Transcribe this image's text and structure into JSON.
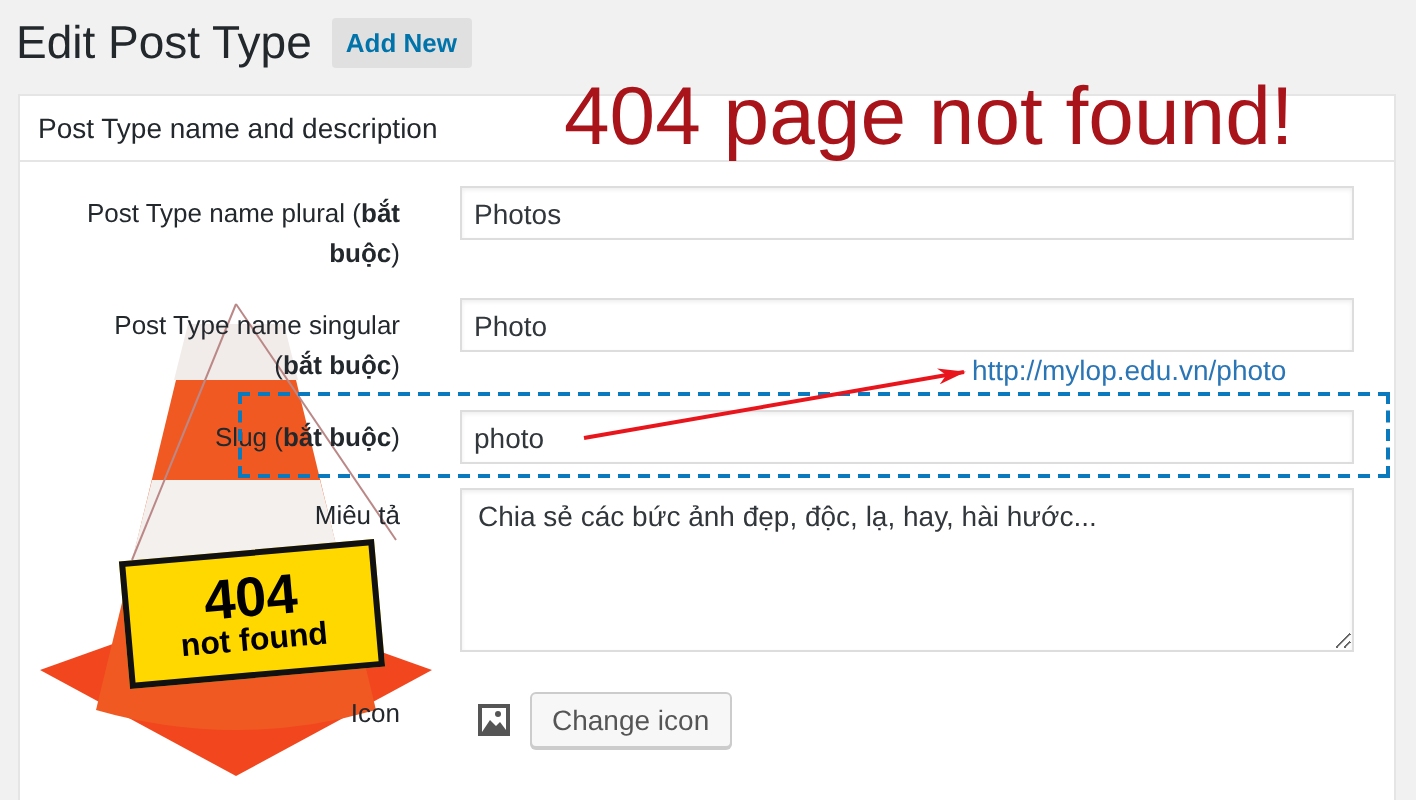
{
  "page": {
    "title": "Edit Post Type",
    "add_new_button": "Add New"
  },
  "panel": {
    "heading": "Post Type name and description",
    "fields": [
      {
        "kind": "text",
        "label": "Post Type name plural (**bắt buộc**)",
        "value": "Photos",
        "highlighted": false
      },
      {
        "kind": "text",
        "label": "Post Type name singular (**bắt buộc**)",
        "value": "Photo",
        "highlighted": false
      },
      {
        "kind": "text",
        "label": "Slug (**bắt buộc**)",
        "value": "photo",
        "highlighted": true
      },
      {
        "kind": "textarea",
        "label": "Miêu tả",
        "value": "Chia sẻ các bức ảnh đẹp, độc, lạ, hay, hài hước...",
        "highlighted": false
      },
      {
        "kind": "icon",
        "label": "Icon",
        "button": "Change icon",
        "highlighted": false
      }
    ]
  },
  "annotations": {
    "headline": "404 page not found!",
    "url": "http://mylop.edu.vn/photo",
    "sign_line_1": "404",
    "sign_line_2": "not found"
  }
}
